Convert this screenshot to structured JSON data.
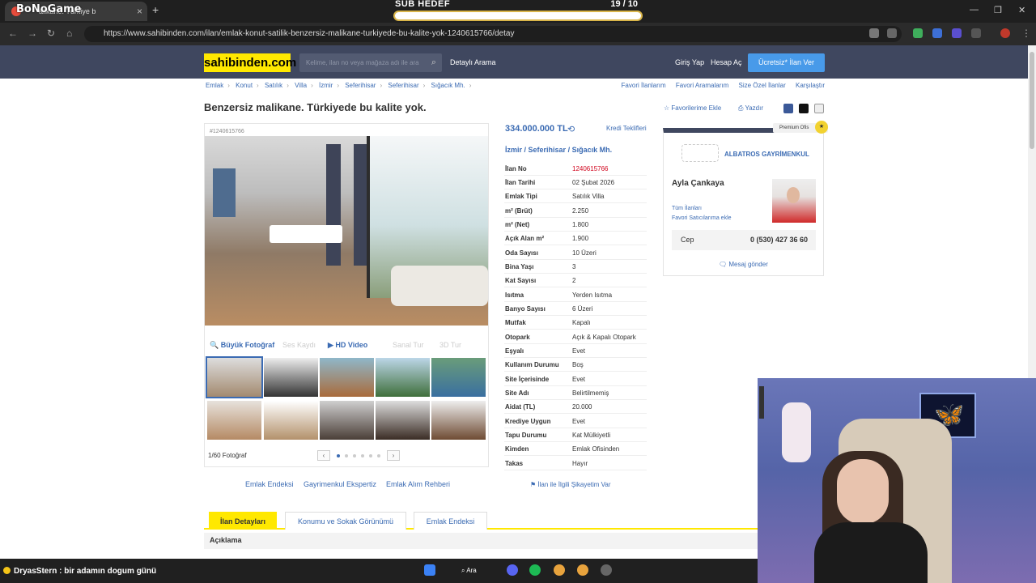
{
  "browser": {
    "tab_title": "alikane. Türkiye b",
    "overlay_logo": "BoNoGame",
    "url": "https://www.sahibinden.com/ilan/emlak-konut-satilik-benzersiz-malikane-turkiyede-bu-kalite-yok-1240615766/detay",
    "window_controls": [
      "—",
      "❐",
      "✕"
    ]
  },
  "subgoal": {
    "label": "SUB HEDEF",
    "count": "19 / 10"
  },
  "site": {
    "logo": "sahibinden.com",
    "search_placeholder": "Kelime, ilan no veya mağaza adı ile ara",
    "detailed_search": "Detaylı Arama",
    "login": "Giriş Yap",
    "register": "Hesap Aç",
    "post_ad": "Ücretsiz* İlan Ver"
  },
  "breadcrumbs": [
    "Emlak",
    "Konut",
    "Satılık",
    "Villa",
    "İzmir",
    "Seferihisar",
    "Seferihisar",
    "Sığacık Mh."
  ],
  "top_links": [
    "Favori İlanlarım",
    "Favori Aramalarım",
    "Size Özel İlanlar",
    "Karşılaştır"
  ],
  "listing": {
    "title": "Benzersiz malikane. Türkiyede bu kalite yok.",
    "favorites": "Favorilerime Ekle",
    "print": "Yazdır",
    "gallery_id": "#1240615766",
    "gallery_tabs": {
      "big_photo": "Büyük Fotoğraf",
      "video": "HD Video",
      "dim1": "Ses Kaydı",
      "dim2": "Sanal Tur",
      "dim3": "3D Tur"
    },
    "photo_count": "1/60 Fotoğraf",
    "price": "334.000.000 TL",
    "credit": "Kredi Teklifleri",
    "location": [
      "İzmir",
      "Seferihisar",
      "Sığacık Mh."
    ],
    "under_links": [
      "Emlak Endeksi",
      "Gayrimenkul Ekspertiz",
      "Emlak Alım Rehberi"
    ],
    "complain": "İlan ile İlgili Şikayetim Var"
  },
  "details": [
    {
      "k": "İlan No",
      "v": "1240615766"
    },
    {
      "k": "İlan Tarihi",
      "v": "02 Şubat 2026"
    },
    {
      "k": "Emlak Tipi",
      "v": "Satılık Villa"
    },
    {
      "k": "m² (Brüt)",
      "v": "2.250"
    },
    {
      "k": "m² (Net)",
      "v": "1.800"
    },
    {
      "k": "Açık Alan m²",
      "v": "1.900"
    },
    {
      "k": "Oda Sayısı",
      "v": "10 Üzeri"
    },
    {
      "k": "Bina Yaşı",
      "v": "3"
    },
    {
      "k": "Kat Sayısı",
      "v": "2"
    },
    {
      "k": "Isıtma",
      "v": "Yerden Isıtma"
    },
    {
      "k": "Banyo Sayısı",
      "v": "6 Üzeri"
    },
    {
      "k": "Mutfak",
      "v": "Kapalı"
    },
    {
      "k": "Otopark",
      "v": "Açık & Kapalı Otopark"
    },
    {
      "k": "Eşyalı",
      "v": "Evet"
    },
    {
      "k": "Kullanım Durumu",
      "v": "Boş"
    },
    {
      "k": "Site İçerisinde",
      "v": "Evet"
    },
    {
      "k": "Site Adı",
      "v": "Belirtilmemiş"
    },
    {
      "k": "Aidat (TL)",
      "v": "20.000"
    },
    {
      "k": "Krediye Uygun",
      "v": "Evet"
    },
    {
      "k": "Tapu Durumu",
      "v": "Kat Mülkiyetli"
    },
    {
      "k": "Kimden",
      "v": "Emlak Ofisinden"
    },
    {
      "k": "Takas",
      "v": "Hayır"
    }
  ],
  "seller": {
    "premium": "Premium Ofis",
    "agency": "ALBATROS GAYRİMENKUL",
    "agent": "Ayla Çankaya",
    "all_ads": "Tüm İlanları",
    "fav_seller": "Favori Satıcılarıma ekle",
    "phone_label": "Cep",
    "phone": "0 (530) 427 36 60",
    "message": "Mesaj gönder"
  },
  "bottom_tabs": [
    "İlan Detayları",
    "Konumu ve Sokak Görünümü",
    "Emlak Endeksi"
  ],
  "description_header": "Açıklama",
  "chat": {
    "user": "DryasStern",
    "message": ": bir adamın dogum günü"
  },
  "taskbar": {
    "search": "Ara"
  },
  "colors": {
    "header": "#3f475f",
    "logo_bg": "#ffe800",
    "link": "#3b6bb3",
    "cta": "#489ae9",
    "ad_no": "#d0021b"
  }
}
